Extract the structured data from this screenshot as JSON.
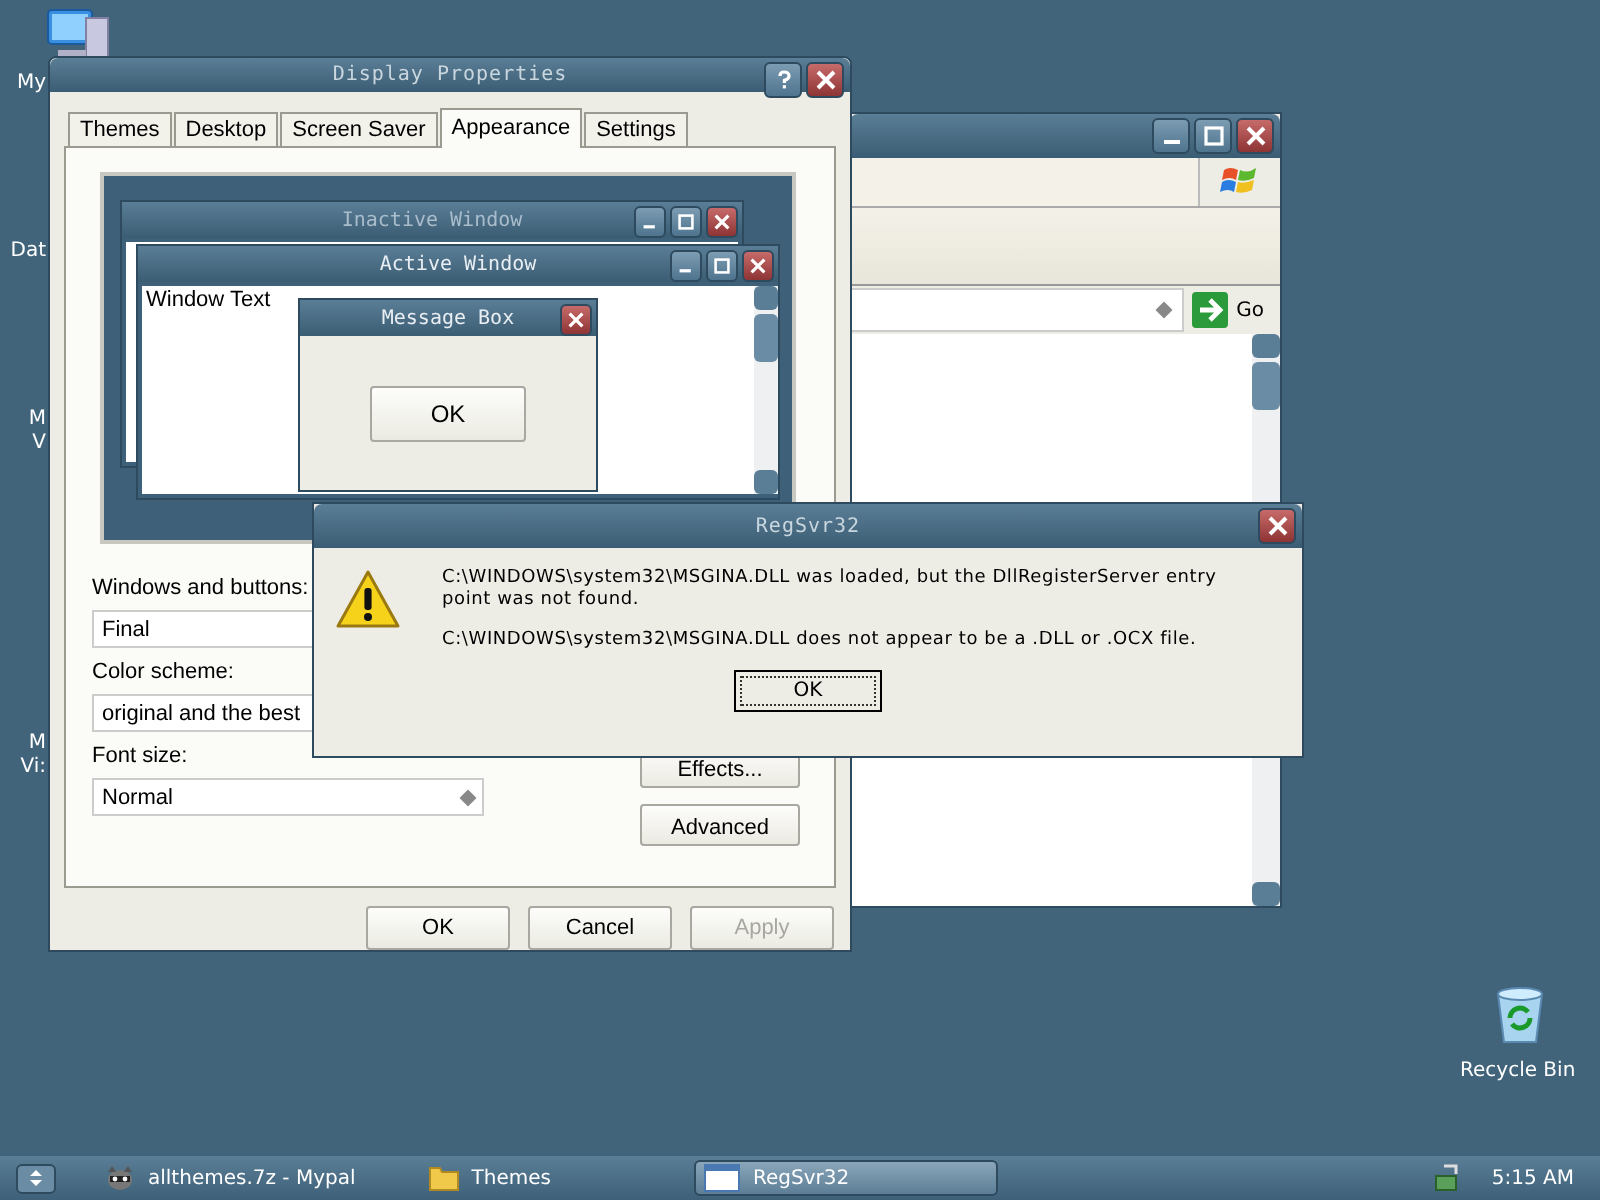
{
  "desktop": {
    "icon_labels": [
      {
        "lines": [
          "My"
        ]
      },
      {
        "lines": [
          "Dat"
        ]
      },
      {
        "lines": [
          "M",
          "V"
        ]
      },
      {
        "lines": [
          "M",
          "Vi:"
        ]
      }
    ],
    "recycle_bin": {
      "label": "Recycle Bin"
    }
  },
  "browser_window": {
    "go_label": "Go"
  },
  "display_properties": {
    "title": "Display Properties",
    "tabs": [
      {
        "label": "Themes",
        "selected": false
      },
      {
        "label": "Desktop",
        "selected": false
      },
      {
        "label": "Screen Saver",
        "selected": false
      },
      {
        "label": "Appearance",
        "selected": true
      },
      {
        "label": "Settings",
        "selected": false
      }
    ],
    "preview": {
      "inactive_title": "Inactive Window",
      "active_title": "Active Window",
      "window_text": "Window Text",
      "message_title": "Message Box",
      "message_button": "OK"
    },
    "fields": [
      {
        "label": "Windows and buttons:",
        "value": "Final"
      },
      {
        "label": "Color scheme:",
        "value": "original and the best"
      },
      {
        "label": "Font size:",
        "value": "Normal"
      }
    ],
    "side_buttons": [
      "Effects...",
      "Advanced"
    ],
    "buttons": [
      {
        "label": "OK",
        "disabled": false
      },
      {
        "label": "Cancel",
        "disabled": false
      },
      {
        "label": "Apply",
        "disabled": true
      }
    ]
  },
  "regsvr_dialog": {
    "title": "RegSvr32",
    "messages": [
      "C:\\WINDOWS\\system32\\MSGINA.DLL was loaded, but the DllRegisterServer entry point was not found.",
      "C:\\WINDOWS\\system32\\MSGINA.DLL does not appear to be a .DLL or .OCX file."
    ],
    "button": "OK"
  },
  "taskbar": {
    "items": [
      {
        "label": "allthemes.7z - Mypal",
        "kind": "app",
        "selected": false
      },
      {
        "label": "Themes",
        "kind": "folder",
        "selected": false
      },
      {
        "label": "RegSvr32",
        "kind": "window",
        "selected": true
      }
    ],
    "clock": "5:15 AM"
  }
}
